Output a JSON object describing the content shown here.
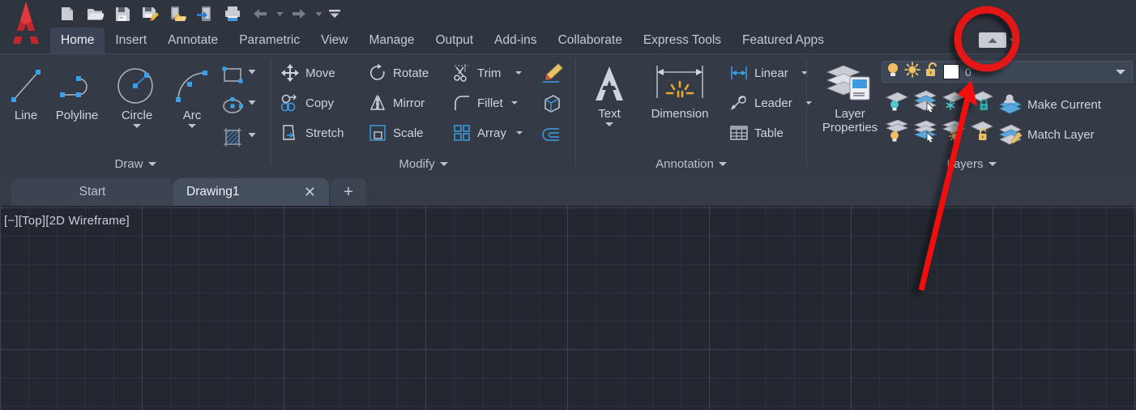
{
  "app": {
    "name": "AutoCAD",
    "logo_icon": "autocad-a-logo"
  },
  "quick_access_toolbar": {
    "items": [
      {
        "icon": "new-document-icon",
        "label": "New"
      },
      {
        "icon": "open-folder-icon",
        "label": "Open"
      },
      {
        "icon": "save-floppy-icon",
        "label": "Save"
      },
      {
        "icon": "save-as-floppy-pencil-icon",
        "label": "Save As"
      },
      {
        "icon": "open-from-web-icon",
        "label": "Open from Web & Mobile"
      },
      {
        "icon": "save-to-web-icon",
        "label": "Save to Web & Mobile"
      },
      {
        "icon": "printer-icon",
        "label": "Plot"
      },
      {
        "icon": "undo-arrow-icon",
        "label": "Undo"
      },
      {
        "icon": "undo-dropdown-caret-icon",
        "label": "Undo options"
      },
      {
        "icon": "redo-arrow-icon",
        "label": "Redo"
      },
      {
        "icon": "redo-dropdown-caret-icon",
        "label": "Redo options"
      },
      {
        "icon": "customize-qat-caret-icon",
        "label": "Customize Quick Access Toolbar"
      }
    ]
  },
  "ribbon": {
    "tabs": [
      {
        "label": "Home",
        "active": true
      },
      {
        "label": "Insert",
        "active": false
      },
      {
        "label": "Annotate",
        "active": false
      },
      {
        "label": "Parametric",
        "active": false
      },
      {
        "label": "View",
        "active": false
      },
      {
        "label": "Manage",
        "active": false
      },
      {
        "label": "Output",
        "active": false
      },
      {
        "label": "Add-ins",
        "active": false
      },
      {
        "label": "Collaborate",
        "active": false
      },
      {
        "label": "Express Tools",
        "active": false
      },
      {
        "label": "Featured Apps",
        "active": false
      }
    ],
    "minimize_button": {
      "icon": "ribbon-minimize-up-arrow-icon",
      "caret_icon": "ribbon-minimize-caret-icon",
      "highlighted": true
    },
    "panels": [
      {
        "title": "Draw",
        "big_tools": [
          {
            "label": "Line",
            "icon": "line-icon",
            "has_dropdown": false
          },
          {
            "label": "Polyline",
            "icon": "polyline-icon",
            "has_dropdown": false
          },
          {
            "label": "Circle",
            "icon": "circle-icon",
            "has_dropdown": true
          },
          {
            "label": "Arc",
            "icon": "arc-icon",
            "has_dropdown": true
          }
        ],
        "icon_tools": [
          {
            "label": "Rectangle",
            "icon": "rectangle-icon",
            "has_dropdown": true
          },
          {
            "label": "Ellipse",
            "icon": "ellipse-icon",
            "has_dropdown": true
          },
          {
            "label": "Hatch",
            "icon": "hatch-icon",
            "has_dropdown": true
          }
        ]
      },
      {
        "title": "Modify",
        "tools": [
          {
            "label": "Move",
            "icon": "move-icon",
            "has_dropdown": false
          },
          {
            "label": "Rotate",
            "icon": "rotate-icon",
            "has_dropdown": false
          },
          {
            "label": "Trim",
            "icon": "trim-icon",
            "has_dropdown": true
          },
          {
            "label": "Copy",
            "icon": "copy-icon",
            "has_dropdown": false
          },
          {
            "label": "Mirror",
            "icon": "mirror-icon",
            "has_dropdown": false
          },
          {
            "label": "Fillet",
            "icon": "fillet-icon",
            "has_dropdown": true
          },
          {
            "label": "Stretch",
            "icon": "stretch-icon",
            "has_dropdown": false
          },
          {
            "label": "Scale",
            "icon": "scale-icon",
            "has_dropdown": false
          },
          {
            "label": "Array",
            "icon": "array-icon",
            "has_dropdown": true
          }
        ],
        "extra_icons": [
          {
            "label": "Erase",
            "icon": "erase-pencil-icon"
          },
          {
            "label": "Explode",
            "icon": "explode-cube-icon"
          },
          {
            "label": "Offset",
            "icon": "offset-icon"
          }
        ]
      },
      {
        "title": "Annotation",
        "big_tools": [
          {
            "label": "Text",
            "icon": "text-a-icon",
            "has_dropdown": true
          },
          {
            "label": "Dimension",
            "icon": "dimension-icon",
            "has_dropdown": false
          }
        ],
        "tools": [
          {
            "label": "Linear",
            "icon": "linear-dimension-icon",
            "has_dropdown": true
          },
          {
            "label": "Leader",
            "icon": "leader-icon",
            "has_dropdown": true
          },
          {
            "label": "Table",
            "icon": "table-icon",
            "has_dropdown": false
          }
        ]
      },
      {
        "title": "Layers",
        "big_tools": [
          {
            "label_line1": "Layer",
            "label_line2": "Properties",
            "icon": "layer-properties-icon"
          }
        ],
        "layer_combo": {
          "on_off_icon": "lightbulb-on-icon",
          "freeze_icon": "sun-thaw-icon",
          "lock_icon": "unlocked-padlock-icon",
          "color_swatch": "#ffffff",
          "current_layer": "0",
          "caret_icon": "dropdown-caret-icon"
        },
        "state_icons_row1": [
          {
            "icon": "layer-off-icon"
          },
          {
            "icon": "isolate-layer-icon"
          },
          {
            "icon": "freeze-layer-icon"
          },
          {
            "icon": "lock-layer-icon"
          }
        ],
        "state_icons_row2": [
          {
            "icon": "turn-all-layers-on-icon"
          },
          {
            "icon": "unisolate-layer-icon"
          },
          {
            "icon": "thaw-all-layers-icon"
          },
          {
            "icon": "unlock-layer-icon"
          }
        ],
        "tools": [
          {
            "label": "Make Current",
            "icon": "make-current-icon"
          },
          {
            "label": "Match Layer",
            "icon": "match-layer-icon"
          }
        ]
      }
    ]
  },
  "document_tabs": {
    "tabs": [
      {
        "label": "Start",
        "active": false,
        "closable": false
      },
      {
        "label": "Drawing1",
        "active": true,
        "closable": true,
        "close_icon": "close-x-icon"
      }
    ],
    "new_tab": {
      "icon": "plus-new-tab-icon",
      "label": "+"
    }
  },
  "viewport": {
    "label": "[−][Top][2D Wireframe]",
    "background_color": "#232830",
    "grid_minor_color": "#2a313b",
    "grid_major_color": "#39424e"
  },
  "annotations": [
    {
      "type": "ellipse",
      "name": "red-circle-highlight",
      "color": "#e51212",
      "target": "ribbon-minimize-button"
    },
    {
      "type": "arrow",
      "name": "red-arrow-pointer",
      "color": "#f40f0f",
      "target": "layer-color-swatch"
    }
  ],
  "colors": {
    "window_bg": "#2f353f",
    "ribbon_bg": "#343b47",
    "active_tab_bg": "#3b4454",
    "text": "#cdd4de",
    "accent_blue": "#5fa8d8",
    "annotation_red": "#e51212"
  }
}
